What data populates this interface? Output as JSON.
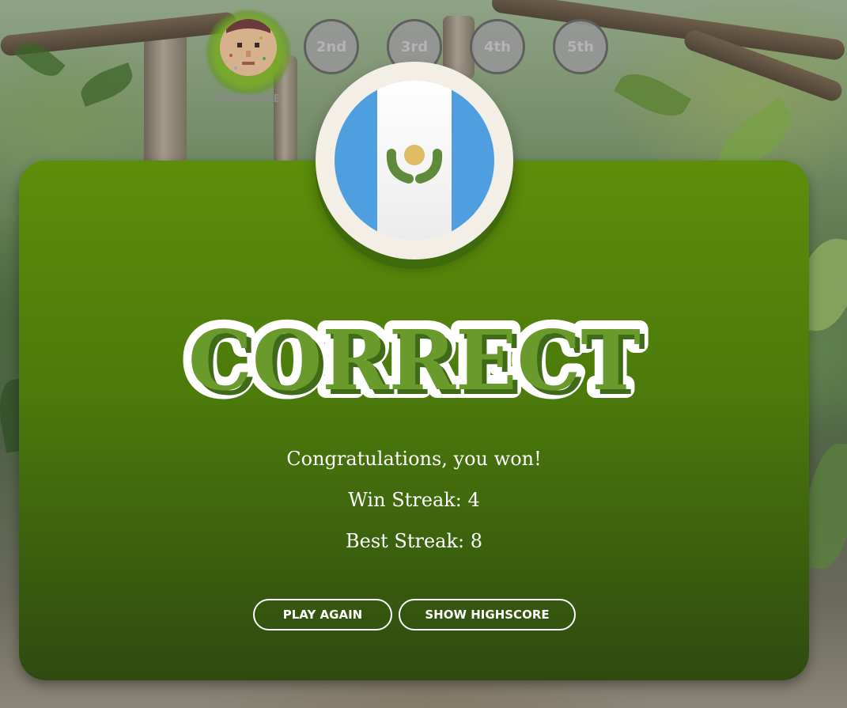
{
  "rounds": {
    "player_name": "SONDRAKE",
    "slots": [
      "2nd",
      "3rd",
      "4th",
      "5th"
    ]
  },
  "result": {
    "title": "CORRECT",
    "message": "Congratulations, you won!",
    "win_streak_label": "Win Streak: 4",
    "best_streak_label": "Best Streak: 8"
  },
  "buttons": {
    "play_again": "PLAY AGAIN",
    "show_highscore": "SHOW HIGHSCORE"
  },
  "flag": {
    "name": "Guatemala flag",
    "stripe_color": "#4f9fe0",
    "center_color": "#ffffff",
    "emblem_color": "#e0bc62"
  },
  "colors": {
    "card_top": "#5d8e0a",
    "card_bottom": "#2f4a10",
    "title_green": "#6a9a2c"
  }
}
